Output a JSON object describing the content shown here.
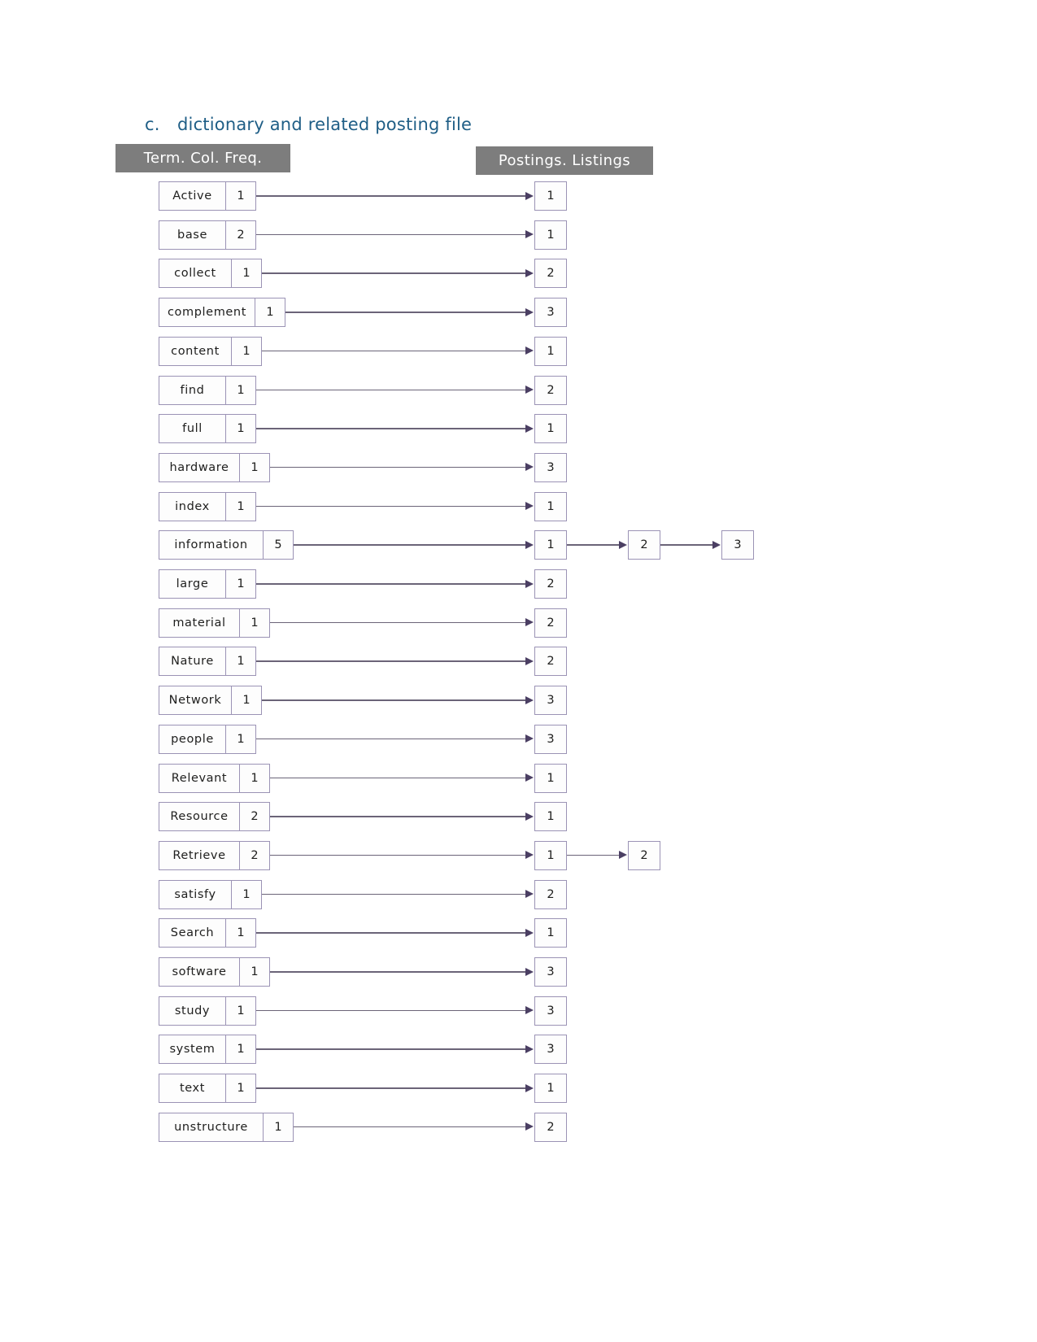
{
  "caption": {
    "marker": "c.",
    "text": "dictionary and related posting file"
  },
  "headers": {
    "left": "Term. Col. Freq.",
    "right": "Postings. Listings"
  },
  "rows": [
    {
      "term": "Active",
      "freq": "1",
      "postings": [
        "1"
      ]
    },
    {
      "term": "base",
      "freq": "2",
      "postings": [
        "1"
      ]
    },
    {
      "term": "collect",
      "freq": "1",
      "postings": [
        "2"
      ]
    },
    {
      "term": "complement",
      "freq": "1",
      "postings": [
        "3"
      ]
    },
    {
      "term": "content",
      "freq": "1",
      "postings": [
        "1"
      ]
    },
    {
      "term": "find",
      "freq": "1",
      "postings": [
        "2"
      ]
    },
    {
      "term": "full",
      "freq": "1",
      "postings": [
        "1"
      ]
    },
    {
      "term": "hardware",
      "freq": "1",
      "postings": [
        "3"
      ]
    },
    {
      "term": "index",
      "freq": "1",
      "postings": [
        "1"
      ]
    },
    {
      "term": "information",
      "freq": "5",
      "postings": [
        "1",
        "2",
        "3"
      ]
    },
    {
      "term": "large",
      "freq": "1",
      "postings": [
        "2"
      ]
    },
    {
      "term": "material",
      "freq": "1",
      "postings": [
        "2"
      ]
    },
    {
      "term": "Nature",
      "freq": "1",
      "postings": [
        "2"
      ]
    },
    {
      "term": "Network",
      "freq": "1",
      "postings": [
        "3"
      ]
    },
    {
      "term": "people",
      "freq": "1",
      "postings": [
        "3"
      ]
    },
    {
      "term": "Relevant",
      "freq": "1",
      "postings": [
        "1"
      ]
    },
    {
      "term": "Resource",
      "freq": "2",
      "postings": [
        "1"
      ]
    },
    {
      "term": "Retrieve",
      "freq": "2",
      "postings": [
        "1",
        "2"
      ]
    },
    {
      "term": "satisfy",
      "freq": "1",
      "postings": [
        "2"
      ]
    },
    {
      "term": "Search",
      "freq": "1",
      "postings": [
        "1"
      ]
    },
    {
      "term": "software",
      "freq": "1",
      "postings": [
        "3"
      ]
    },
    {
      "term": "study",
      "freq": "1",
      "postings": [
        "3"
      ]
    },
    {
      "term": "system",
      "freq": "1",
      "postings": [
        "3"
      ]
    },
    {
      "term": "text",
      "freq": "1",
      "postings": [
        "1"
      ]
    },
    {
      "term": "unstructure",
      "freq": "1",
      "postings": [
        "2"
      ]
    }
  ],
  "colors": {
    "caption": "#1f5e86",
    "banner_bg": "#7d7d7d",
    "box_border": "#9b93b5",
    "arrow": "#6b6478"
  }
}
